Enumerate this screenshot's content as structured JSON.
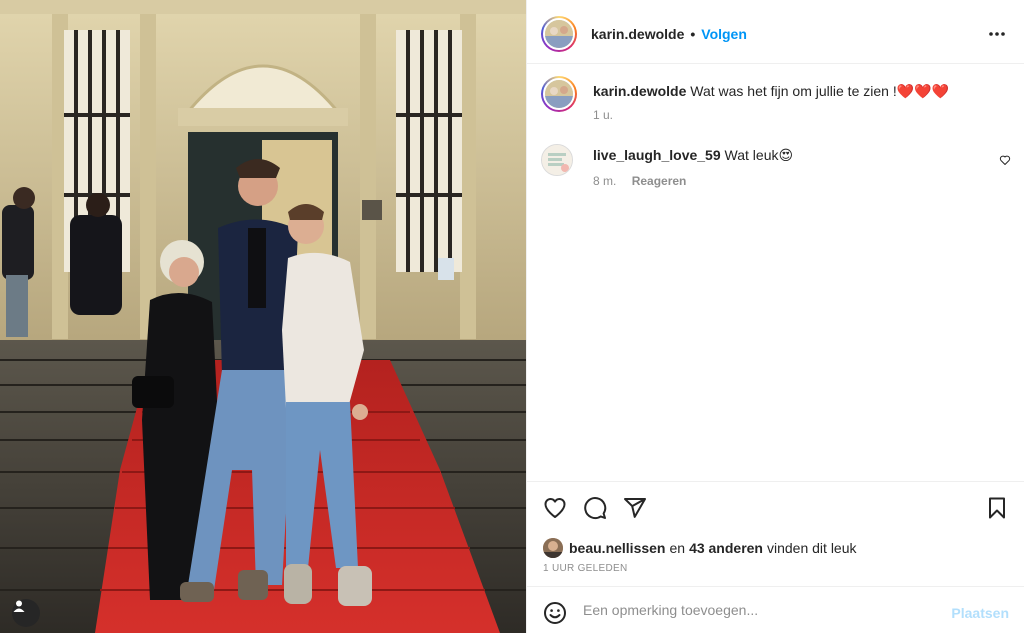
{
  "post": {
    "author": "karin.dewolde",
    "separator": "•",
    "follow_label": "Volgen",
    "more_icon": "more-horizontal-icon"
  },
  "comments": [
    {
      "user": "karin.dewolde",
      "text": "Wat was het fijn om jullie te zien !❤️❤️❤️",
      "time": "1 u."
    },
    {
      "user": "live_laugh_love_59",
      "text": "Wat leuk😍",
      "time": "8 m.",
      "reply_label": "Reageren"
    }
  ],
  "actions": {
    "like_icon": "heart-icon",
    "comment_icon": "comment-icon",
    "share_icon": "send-icon",
    "save_icon": "bookmark-icon"
  },
  "likes": {
    "first_liker": "beau.nellissen",
    "connector": "en",
    "others": "43 anderen",
    "suffix": "vinden dit leuk"
  },
  "timestamp": "1 UUR GELEDEN",
  "add_comment": {
    "placeholder": "Een opmerking toevoegen...",
    "post_label": "Plaatsen",
    "emoji_icon": "emoji-smile-icon"
  },
  "colors": {
    "accent": "#0095f6",
    "post_disabled": "#b2dffc",
    "muted": "#8e8e8e",
    "heart": "#e0245e"
  }
}
